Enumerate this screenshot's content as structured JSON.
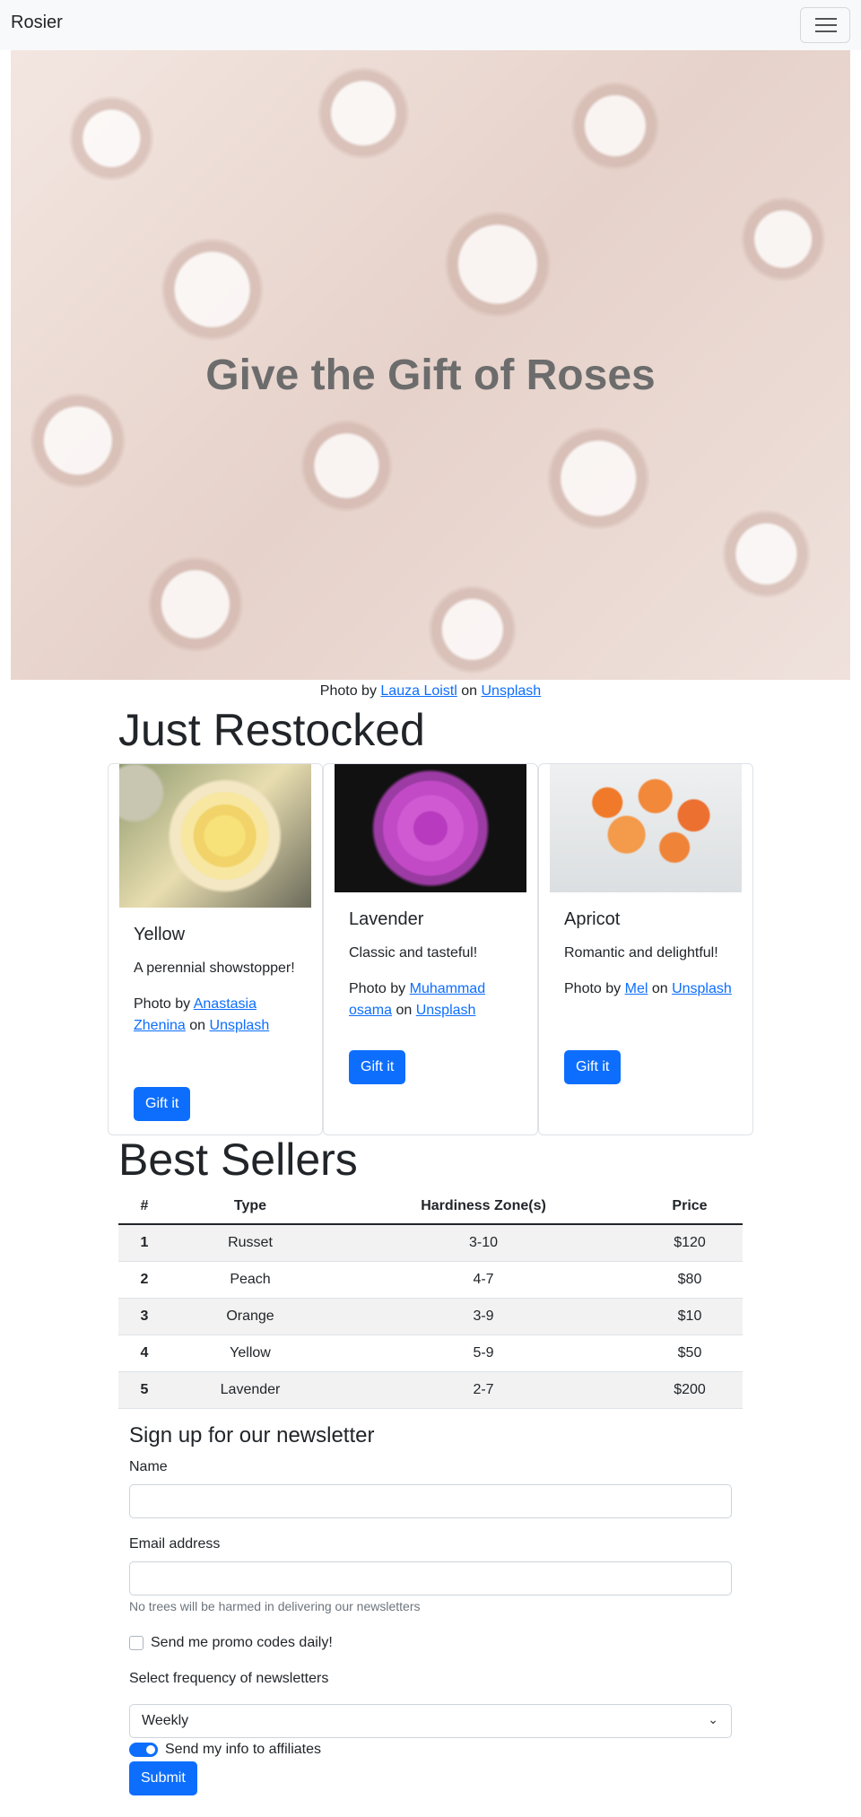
{
  "navbar": {
    "brand": "Rosier",
    "menu_icon": "hamburger-menu-icon"
  },
  "hero": {
    "title": "Give the Gift of Roses"
  },
  "hero_credit": {
    "prefix": "Photo by ",
    "author": "Lauza Loistl",
    "middle": " on ",
    "site": "Unsplash"
  },
  "restocked": {
    "heading": "Just Restocked",
    "cards": [
      {
        "title": "Yellow",
        "text": "A perennial showstopper!",
        "credit_prefix": "Photo by ",
        "author": "Anastasia Zhenina",
        "credit_middle": " on ",
        "site": "Unsplash",
        "button": "Gift it"
      },
      {
        "title": "Lavender",
        "text": "Classic and tasteful!",
        "credit_prefix": "Photo by ",
        "author": "Muhammad osama",
        "credit_middle": " on ",
        "site": "Unsplash",
        "button": "Gift it"
      },
      {
        "title": "Apricot",
        "text": "Romantic and delightful!",
        "credit_prefix": "Photo by ",
        "author": "Mel",
        "credit_middle": " on ",
        "site": "Unsplash",
        "button": "Gift it"
      }
    ]
  },
  "best_sellers": {
    "heading": "Best Sellers",
    "columns": [
      "#",
      "Type",
      "Hardiness Zone(s)",
      "Price"
    ],
    "rows": [
      [
        "1",
        "Russet",
        "3-10",
        "$120"
      ],
      [
        "2",
        "Peach",
        "4-7",
        "$80"
      ],
      [
        "3",
        "Orange",
        "3-9",
        "$10"
      ],
      [
        "4",
        "Yellow",
        "5-9",
        "$50"
      ],
      [
        "5",
        "Lavender",
        "2-7",
        "$200"
      ]
    ]
  },
  "newsletter": {
    "title": "Sign up for our newsletter",
    "name_label": "Name",
    "name_value": "",
    "email_label": "Email address",
    "email_value": "",
    "email_help": "No trees will be harmed in delivering our newsletters",
    "promo_label": "Send me promo codes daily!",
    "promo_checked": false,
    "frequency_label": "Select frequency of newsletters",
    "frequency_value": "Weekly",
    "affiliates_label": "Send my info to affiliates",
    "affiliates_on": true,
    "submit_label": "Submit"
  },
  "colors": {
    "primary": "#0d6efd",
    "navbar_bg": "#f8f9fa",
    "hero_title": "#6c6c6c"
  }
}
